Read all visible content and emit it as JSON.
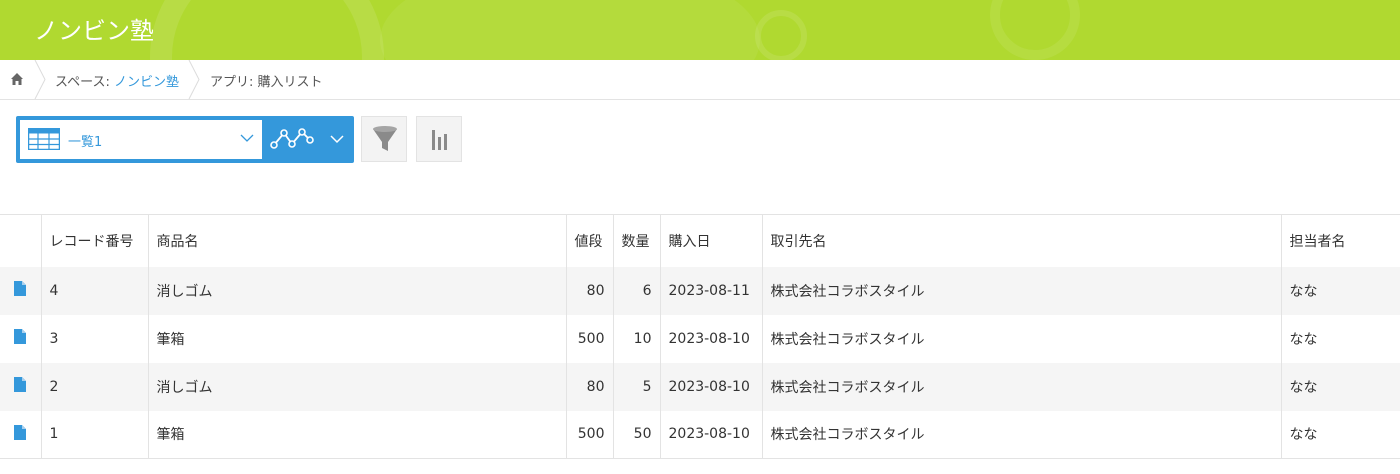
{
  "header": {
    "title": "ノンビン塾",
    "accent_color": "#b0d930"
  },
  "breadcrumb": {
    "home_icon": "home-icon",
    "space_prefix": "スペース: ",
    "space_name": "ノンビン塾",
    "app_label": "アプリ: 購入リスト"
  },
  "toolbar": {
    "view_name": "一覧1",
    "view_icon": "table-grid-icon",
    "graph_icon": "graph-icon",
    "filter_icon": "funnel-icon",
    "chart_icon": "bar-chart-icon",
    "accent_color": "#3498db"
  },
  "table": {
    "columns": [
      "",
      "レコード番号",
      "商品名",
      "値段",
      "数量",
      "購入日",
      "取引先名",
      "担当者名"
    ],
    "rows": [
      {
        "record_no": "4",
        "product": "消しゴム",
        "price": "80",
        "qty": "6",
        "date": "2023-08-11",
        "client": "株式会社コラボスタイル",
        "person": "なな"
      },
      {
        "record_no": "3",
        "product": "筆箱",
        "price": "500",
        "qty": "10",
        "date": "2023-08-10",
        "client": "株式会社コラボスタイル",
        "person": "なな"
      },
      {
        "record_no": "2",
        "product": "消しゴム",
        "price": "80",
        "qty": "5",
        "date": "2023-08-10",
        "client": "株式会社コラボスタイル",
        "person": "なな"
      },
      {
        "record_no": "1",
        "product": "筆箱",
        "price": "500",
        "qty": "50",
        "date": "2023-08-10",
        "client": "株式会社コラボスタイル",
        "person": "なな"
      }
    ]
  }
}
